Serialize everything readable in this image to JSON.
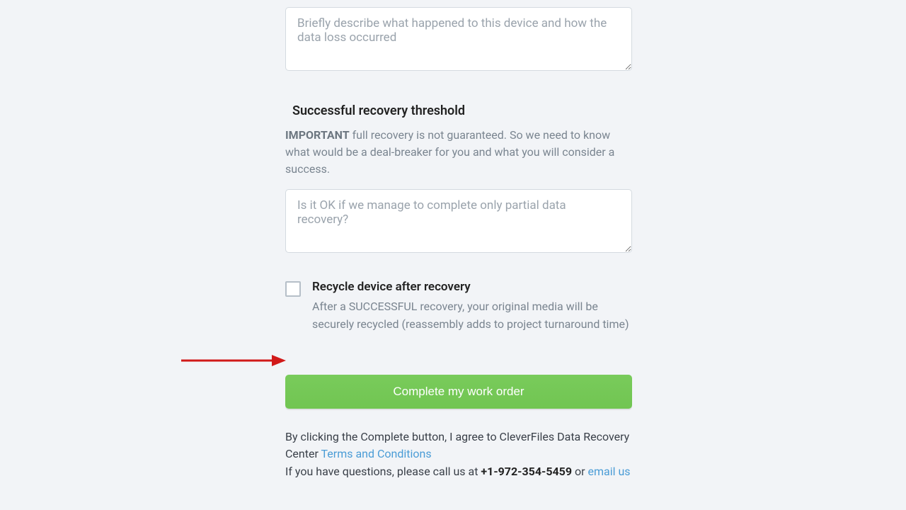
{
  "form": {
    "describe": {
      "placeholder": "Briefly describe what happened to this device and how the data loss occurred",
      "value": ""
    },
    "threshold": {
      "heading": "Successful recovery threshold",
      "important_label": "IMPORTANT",
      "help_text": " full recovery is not guaranteed. So we need to know what would be a deal-breaker for you and what you will consider a success.",
      "placeholder": "Is it OK if we manage to complete only partial data recovery?",
      "value": ""
    },
    "recycle": {
      "label": "Recycle device after recovery",
      "description": "After a SUCCESSFUL recovery, your original media will be securely recycled (reassembly adds to project turnaround time)"
    },
    "submit_label": "Complete my work order",
    "agree": {
      "prefix": "By clicking the Complete button, I agree to CleverFiles Data Recovery Center ",
      "terms_link": "Terms and Conditions",
      "contact_prefix": "If you have questions, please call us at ",
      "phone": "+1-972-354-5459",
      "or_text": " or ",
      "email_link": "email us"
    }
  }
}
